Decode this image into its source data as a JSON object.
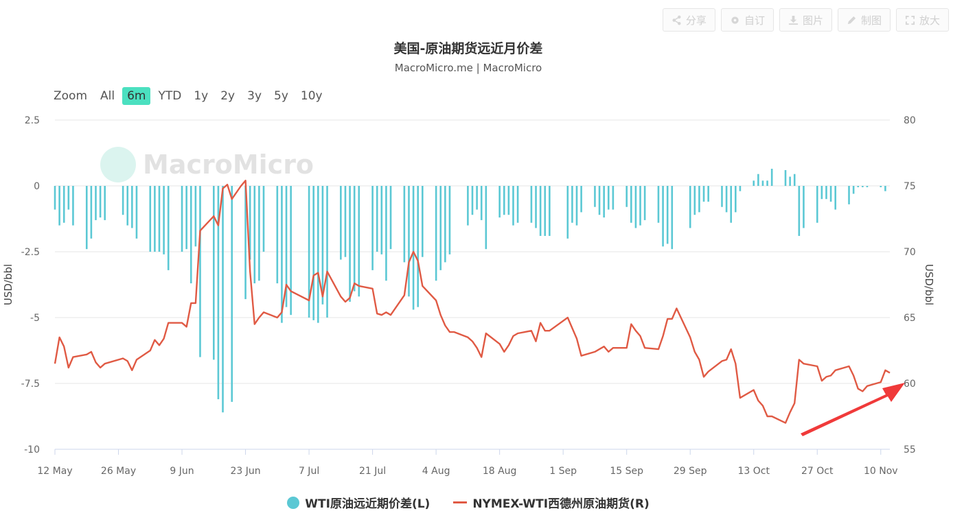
{
  "toolbar": {
    "share": "分享",
    "customize": "自订",
    "image": "图片",
    "draw": "制图",
    "fullscreen": "放大"
  },
  "header": {
    "title": "美国-原油期货远近月价差",
    "subtitle": "MacroMicro.me | MacroMicro"
  },
  "zoom": {
    "label": "Zoom",
    "options": [
      "All",
      "6m",
      "YTD",
      "1y",
      "2y",
      "3y",
      "5y",
      "10y"
    ],
    "active": "6m"
  },
  "watermark": "MacroMicro",
  "colors": {
    "bar": "#5bc8d4",
    "line": "#e05a44",
    "arrow": "#f03a3a",
    "grid": "#e6e6e6"
  },
  "chart_data": {
    "type": "bar+line",
    "title": "美国-原油期货远近月价差",
    "subtitle": "MacroMicro.me | MacroMicro",
    "ylabel_left": "USD/bbl",
    "ylabel_right": "USD/bbl",
    "ylim_left": [
      -10,
      2.5
    ],
    "ylim_right": [
      55,
      80
    ],
    "left_ticks": [
      2.5,
      0,
      -2.5,
      -5,
      -7.5,
      -10
    ],
    "left_tick_labels": [
      "2.5",
      "0",
      "-2.5",
      "-5",
      "-7.5",
      "-10"
    ],
    "right_ticks": [
      80,
      75,
      70,
      65,
      60,
      55
    ],
    "right_tick_labels": [
      "80",
      "75",
      "70",
      "65",
      "60",
      "55"
    ],
    "x_ticks": [
      "2025-05-12",
      "2025-05-26",
      "2025-06-09",
      "2025-06-23",
      "2025-07-07",
      "2025-07-21",
      "2025-08-04",
      "2025-08-18",
      "2025-09-01",
      "2025-09-15",
      "2025-09-29",
      "2025-10-13",
      "2025-10-27",
      "2025-11-10"
    ],
    "x_tick_labels": [
      "12 May",
      "26 May",
      "9 Jun",
      "23 Jun",
      "7 Jul",
      "21 Jul",
      "4 Aug",
      "18 Aug",
      "1 Sep",
      "15 Sep",
      "29 Sep",
      "13 Oct",
      "27 Oct",
      "10 Nov"
    ],
    "x_range": [
      "2025-05-12",
      "2025-11-12"
    ],
    "grid": true,
    "legend_position": "bottom-center",
    "series": [
      {
        "name": "WTI原油远近期价差(L)",
        "type": "bar",
        "axis": "left",
        "data": [
          [
            "2025-05-12",
            -0.9
          ],
          [
            "2025-05-13",
            -1.5
          ],
          [
            "2025-05-14",
            -1.4
          ],
          [
            "2025-05-15",
            -0.9
          ],
          [
            "2025-05-16",
            -1.5
          ],
          [
            "2025-05-19",
            -2.4
          ],
          [
            "2025-05-20",
            -2.0
          ],
          [
            "2025-05-21",
            -1.3
          ],
          [
            "2025-05-22",
            -1.2
          ],
          [
            "2025-05-23",
            -1.3
          ],
          [
            "2025-05-27",
            -1.1
          ],
          [
            "2025-05-28",
            -1.5
          ],
          [
            "2025-05-29",
            -1.6
          ],
          [
            "2025-05-30",
            -2.0
          ],
          [
            "2025-06-02",
            -2.5
          ],
          [
            "2025-06-03",
            -2.5
          ],
          [
            "2025-06-04",
            -2.5
          ],
          [
            "2025-06-05",
            -2.6
          ],
          [
            "2025-06-06",
            -3.2
          ],
          [
            "2025-06-09",
            -2.5
          ],
          [
            "2025-06-10",
            -2.4
          ],
          [
            "2025-06-11",
            -3.7
          ],
          [
            "2025-06-12",
            -2.3
          ],
          [
            "2025-06-13",
            -6.5
          ],
          [
            "2025-06-16",
            -6.6
          ],
          [
            "2025-06-17",
            -8.1
          ],
          [
            "2025-06-18",
            -8.6
          ],
          [
            "2025-06-20",
            -8.2
          ],
          [
            "2025-06-23",
            -4.3
          ],
          [
            "2025-06-24",
            -2.8
          ],
          [
            "2025-06-25",
            -3.7
          ],
          [
            "2025-06-26",
            -3.6
          ],
          [
            "2025-06-27",
            -2.5
          ],
          [
            "2025-06-30",
            -3.7
          ],
          [
            "2025-07-01",
            -5.2
          ],
          [
            "2025-07-02",
            -4.6
          ],
          [
            "2025-07-03",
            -4.9
          ],
          [
            "2025-07-07",
            -5.0
          ],
          [
            "2025-07-08",
            -5.1
          ],
          [
            "2025-07-09",
            -5.2
          ],
          [
            "2025-07-10",
            -4.5
          ],
          [
            "2025-07-11",
            -5.0
          ],
          [
            "2025-07-14",
            -2.8
          ],
          [
            "2025-07-15",
            -2.7
          ],
          [
            "2025-07-16",
            -4.4
          ],
          [
            "2025-07-17",
            -4.0
          ],
          [
            "2025-07-18",
            -4.2
          ],
          [
            "2025-07-21",
            -3.2
          ],
          [
            "2025-07-22",
            -2.5
          ],
          [
            "2025-07-23",
            -2.6
          ],
          [
            "2025-07-24",
            -3.6
          ],
          [
            "2025-07-25",
            -2.4
          ],
          [
            "2025-07-28",
            -2.9
          ],
          [
            "2025-07-29",
            -4.2
          ],
          [
            "2025-07-30",
            -4.7
          ],
          [
            "2025-07-31",
            -4.6
          ],
          [
            "2025-08-01",
            -2.7
          ],
          [
            "2025-08-04",
            -3.6
          ],
          [
            "2025-08-05",
            -3.2
          ],
          [
            "2025-08-06",
            -2.9
          ],
          [
            "2025-08-07",
            -2.6
          ],
          [
            "2025-08-11",
            -1.5
          ],
          [
            "2025-08-12",
            -1.1
          ],
          [
            "2025-08-13",
            -0.9
          ],
          [
            "2025-08-14",
            -1.3
          ],
          [
            "2025-08-15",
            -2.4
          ],
          [
            "2025-08-18",
            -1.2
          ],
          [
            "2025-08-19",
            -1.1
          ],
          [
            "2025-08-20",
            -1.1
          ],
          [
            "2025-08-21",
            -1.5
          ],
          [
            "2025-08-22",
            -1.4
          ],
          [
            "2025-08-25",
            -1.4
          ],
          [
            "2025-08-26",
            -1.6
          ],
          [
            "2025-08-27",
            -1.9
          ],
          [
            "2025-08-28",
            -1.9
          ],
          [
            "2025-08-29",
            -1.9
          ],
          [
            "2025-09-02",
            -2.0
          ],
          [
            "2025-09-03",
            -1.4
          ],
          [
            "2025-09-04",
            -1.5
          ],
          [
            "2025-09-05",
            -1.0
          ],
          [
            "2025-09-08",
            -0.8
          ],
          [
            "2025-09-09",
            -1.1
          ],
          [
            "2025-09-10",
            -1.2
          ],
          [
            "2025-09-11",
            -0.9
          ],
          [
            "2025-09-12",
            -0.9
          ],
          [
            "2025-09-15",
            -0.8
          ],
          [
            "2025-09-16",
            -1.4
          ],
          [
            "2025-09-17",
            -1.6
          ],
          [
            "2025-09-18",
            -1.5
          ],
          [
            "2025-09-19",
            -1.3
          ],
          [
            "2025-09-22",
            -1.4
          ],
          [
            "2025-09-23",
            -2.3
          ],
          [
            "2025-09-24",
            -2.2
          ],
          [
            "2025-09-25",
            -2.4
          ],
          [
            "2025-09-29",
            -1.6
          ],
          [
            "2025-09-30",
            -1.1
          ],
          [
            "2025-10-01",
            -1.0
          ],
          [
            "2025-10-02",
            -0.6
          ],
          [
            "2025-10-03",
            -0.6
          ],
          [
            "2025-10-06",
            -0.8
          ],
          [
            "2025-10-07",
            -1.0
          ],
          [
            "2025-10-08",
            -1.4
          ],
          [
            "2025-10-09",
            -1.0
          ],
          [
            "2025-10-10",
            -0.2
          ],
          [
            "2025-10-13",
            0.2
          ],
          [
            "2025-10-14",
            0.45
          ],
          [
            "2025-10-15",
            0.2
          ],
          [
            "2025-10-16",
            0.2
          ],
          [
            "2025-10-17",
            0.65
          ],
          [
            "2025-10-20",
            0.6
          ],
          [
            "2025-10-21",
            0.35
          ],
          [
            "2025-10-22",
            0.45
          ],
          [
            "2025-10-23",
            -1.9
          ],
          [
            "2025-10-24",
            -1.6
          ],
          [
            "2025-10-27",
            -1.4
          ],
          [
            "2025-10-28",
            -0.5
          ],
          [
            "2025-10-29",
            -0.5
          ],
          [
            "2025-10-30",
            -0.6
          ],
          [
            "2025-10-31",
            -0.9
          ],
          [
            "2025-11-03",
            -0.7
          ],
          [
            "2025-11-04",
            -0.3
          ],
          [
            "2025-11-05",
            -0.05
          ],
          [
            "2025-11-06",
            -0.05
          ],
          [
            "2025-11-07",
            -0.05
          ],
          [
            "2025-11-10",
            -0.05
          ],
          [
            "2025-11-11",
            -0.2
          ]
        ]
      },
      {
        "name": "NYMEX-WTI西德州原油期货(R)",
        "type": "line",
        "axis": "right",
        "data": [
          [
            "2025-05-12",
            61.5
          ],
          [
            "2025-05-13",
            63.5
          ],
          [
            "2025-05-14",
            62.8
          ],
          [
            "2025-05-15",
            61.2
          ],
          [
            "2025-05-16",
            62.0
          ],
          [
            "2025-05-19",
            62.2
          ],
          [
            "2025-05-20",
            62.4
          ],
          [
            "2025-05-21",
            61.6
          ],
          [
            "2025-05-22",
            61.2
          ],
          [
            "2025-05-23",
            61.5
          ],
          [
            "2025-05-27",
            61.9
          ],
          [
            "2025-05-28",
            61.7
          ],
          [
            "2025-05-29",
            61.0
          ],
          [
            "2025-05-30",
            61.8
          ],
          [
            "2025-06-02",
            62.5
          ],
          [
            "2025-06-03",
            63.3
          ],
          [
            "2025-06-04",
            62.9
          ],
          [
            "2025-06-05",
            63.4
          ],
          [
            "2025-06-06",
            64.6
          ],
          [
            "2025-06-09",
            64.6
          ],
          [
            "2025-06-10",
            64.3
          ],
          [
            "2025-06-11",
            66.1
          ],
          [
            "2025-06-12",
            66.1
          ],
          [
            "2025-06-13",
            71.6
          ],
          [
            "2025-06-16",
            72.7
          ],
          [
            "2025-06-17",
            72.0
          ],
          [
            "2025-06-18",
            74.8
          ],
          [
            "2025-06-19",
            75.1
          ],
          [
            "2025-06-20",
            74.0
          ],
          [
            "2025-06-22",
            75.0
          ],
          [
            "2025-06-23",
            75.4
          ],
          [
            "2025-06-24",
            68.5
          ],
          [
            "2025-06-25",
            64.5
          ],
          [
            "2025-06-26",
            65.0
          ],
          [
            "2025-06-27",
            65.4
          ],
          [
            "2025-06-30",
            65.0
          ],
          [
            "2025-07-01",
            65.4
          ],
          [
            "2025-07-02",
            67.5
          ],
          [
            "2025-07-03",
            67.0
          ],
          [
            "2025-07-07",
            66.3
          ],
          [
            "2025-07-08",
            68.2
          ],
          [
            "2025-07-09",
            68.4
          ],
          [
            "2025-07-10",
            66.6
          ],
          [
            "2025-07-11",
            68.5
          ],
          [
            "2025-07-14",
            66.6
          ],
          [
            "2025-07-15",
            66.2
          ],
          [
            "2025-07-16",
            66.5
          ],
          [
            "2025-07-17",
            67.6
          ],
          [
            "2025-07-18",
            67.4
          ],
          [
            "2025-07-21",
            67.2
          ],
          [
            "2025-07-22",
            65.3
          ],
          [
            "2025-07-23",
            65.2
          ],
          [
            "2025-07-24",
            65.4
          ],
          [
            "2025-07-25",
            65.2
          ],
          [
            "2025-07-28",
            66.7
          ],
          [
            "2025-07-29",
            69.2
          ],
          [
            "2025-07-30",
            70.0
          ],
          [
            "2025-07-31",
            69.3
          ],
          [
            "2025-08-01",
            67.4
          ],
          [
            "2025-08-04",
            66.3
          ],
          [
            "2025-08-05",
            65.2
          ],
          [
            "2025-08-06",
            64.4
          ],
          [
            "2025-08-07",
            63.9
          ],
          [
            "2025-08-08",
            63.9
          ],
          [
            "2025-08-11",
            63.5
          ],
          [
            "2025-08-12",
            63.2
          ],
          [
            "2025-08-13",
            62.7
          ],
          [
            "2025-08-14",
            62.0
          ],
          [
            "2025-08-15",
            63.8
          ],
          [
            "2025-08-18",
            63.0
          ],
          [
            "2025-08-19",
            62.4
          ],
          [
            "2025-08-20",
            62.9
          ],
          [
            "2025-08-21",
            63.6
          ],
          [
            "2025-08-22",
            63.8
          ],
          [
            "2025-08-25",
            64.0
          ],
          [
            "2025-08-26",
            63.2
          ],
          [
            "2025-08-27",
            64.6
          ],
          [
            "2025-08-28",
            64.0
          ],
          [
            "2025-08-29",
            64.0
          ],
          [
            "2025-09-02",
            65.0
          ],
          [
            "2025-09-03",
            64.2
          ],
          [
            "2025-09-04",
            63.4
          ],
          [
            "2025-09-05",
            62.1
          ],
          [
            "2025-09-08",
            62.4
          ],
          [
            "2025-09-09",
            62.6
          ],
          [
            "2025-09-10",
            62.8
          ],
          [
            "2025-09-11",
            62.4
          ],
          [
            "2025-09-12",
            62.7
          ],
          [
            "2025-09-15",
            62.7
          ],
          [
            "2025-09-16",
            64.5
          ],
          [
            "2025-09-17",
            64.0
          ],
          [
            "2025-09-18",
            63.6
          ],
          [
            "2025-09-19",
            62.7
          ],
          [
            "2025-09-22",
            62.6
          ],
          [
            "2025-09-23",
            63.6
          ],
          [
            "2025-09-24",
            64.9
          ],
          [
            "2025-09-25",
            64.9
          ],
          [
            "2025-09-26",
            65.7
          ],
          [
            "2025-09-29",
            63.5
          ],
          [
            "2025-09-30",
            62.4
          ],
          [
            "2025-10-01",
            61.8
          ],
          [
            "2025-10-02",
            60.5
          ],
          [
            "2025-10-03",
            60.9
          ],
          [
            "2025-10-06",
            61.7
          ],
          [
            "2025-10-07",
            61.8
          ],
          [
            "2025-10-08",
            62.6
          ],
          [
            "2025-10-09",
            61.5
          ],
          [
            "2025-10-10",
            58.9
          ],
          [
            "2025-10-13",
            59.5
          ],
          [
            "2025-10-14",
            58.7
          ],
          [
            "2025-10-15",
            58.3
          ],
          [
            "2025-10-16",
            57.5
          ],
          [
            "2025-10-17",
            57.5
          ],
          [
            "2025-10-20",
            57.0
          ],
          [
            "2025-10-21",
            57.8
          ],
          [
            "2025-10-22",
            58.5
          ],
          [
            "2025-10-23",
            61.8
          ],
          [
            "2025-10-24",
            61.5
          ],
          [
            "2025-10-27",
            61.3
          ],
          [
            "2025-10-28",
            60.2
          ],
          [
            "2025-10-29",
            60.5
          ],
          [
            "2025-10-30",
            60.6
          ],
          [
            "2025-10-31",
            61.0
          ],
          [
            "2025-11-03",
            61.3
          ],
          [
            "2025-11-04",
            60.6
          ],
          [
            "2025-11-05",
            59.6
          ],
          [
            "2025-11-06",
            59.4
          ],
          [
            "2025-11-07",
            59.8
          ],
          [
            "2025-11-10",
            60.1
          ],
          [
            "2025-11-11",
            61.0
          ],
          [
            "2025-11-12",
            60.8
          ]
        ]
      }
    ]
  }
}
